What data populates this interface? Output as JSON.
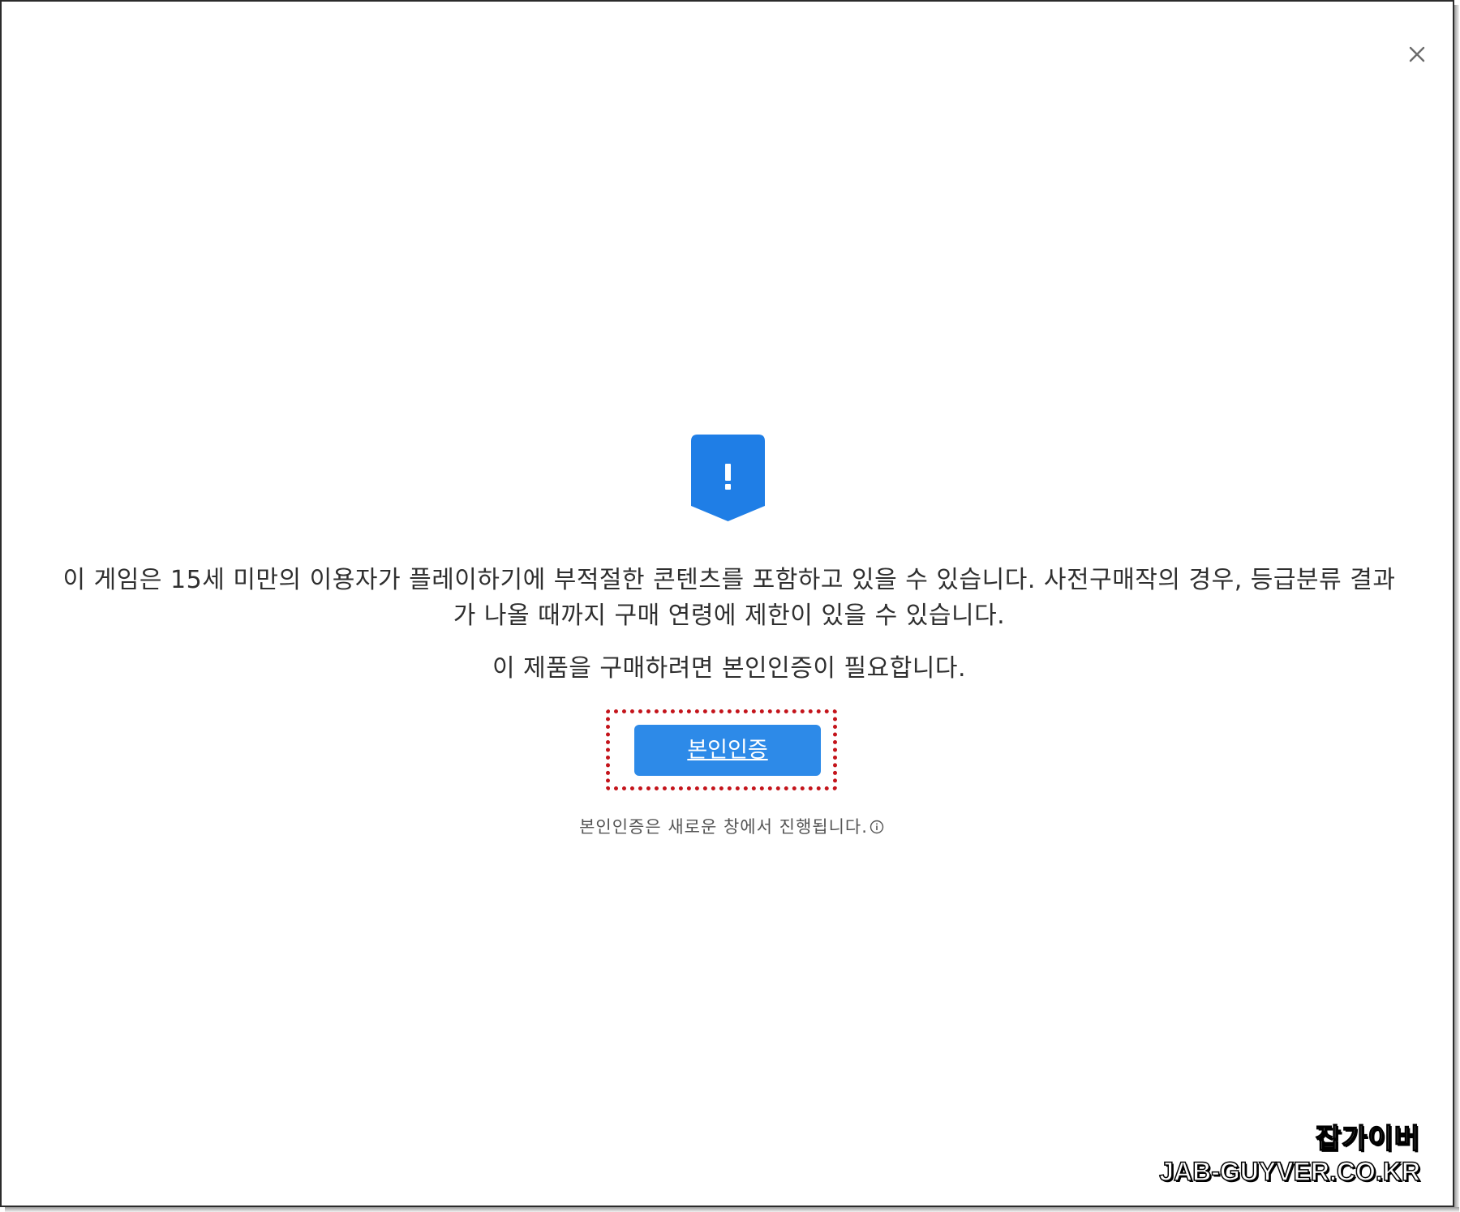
{
  "dialog": {
    "message_line1": "이 게임은 15세 미만의 이용자가 플레이하기에 부적절한 콘텐츠를 포함하고 있을 수 있습니다. 사전구매작의 경우, 등급분류 결과",
    "message_line2": "가 나올 때까지 구매 연령에 제한이 있을 수 있습니다.",
    "prompt": "이 제품을 구매하려면 본인인증이 필요합니다.",
    "verify_button_label": "본인인증",
    "note": "본인인증은 새로운 창에서 진행됩니다.",
    "icons": {
      "close": "close-icon",
      "warning": "warning-shield-icon",
      "info": "info-icon"
    },
    "colors": {
      "accent": "#2d8ae8",
      "highlight": "#c4141b",
      "shield": "#1f7ee6"
    }
  },
  "watermark": {
    "name": "잡가이버",
    "url": "JAB-GUYVER.CO.KR"
  }
}
